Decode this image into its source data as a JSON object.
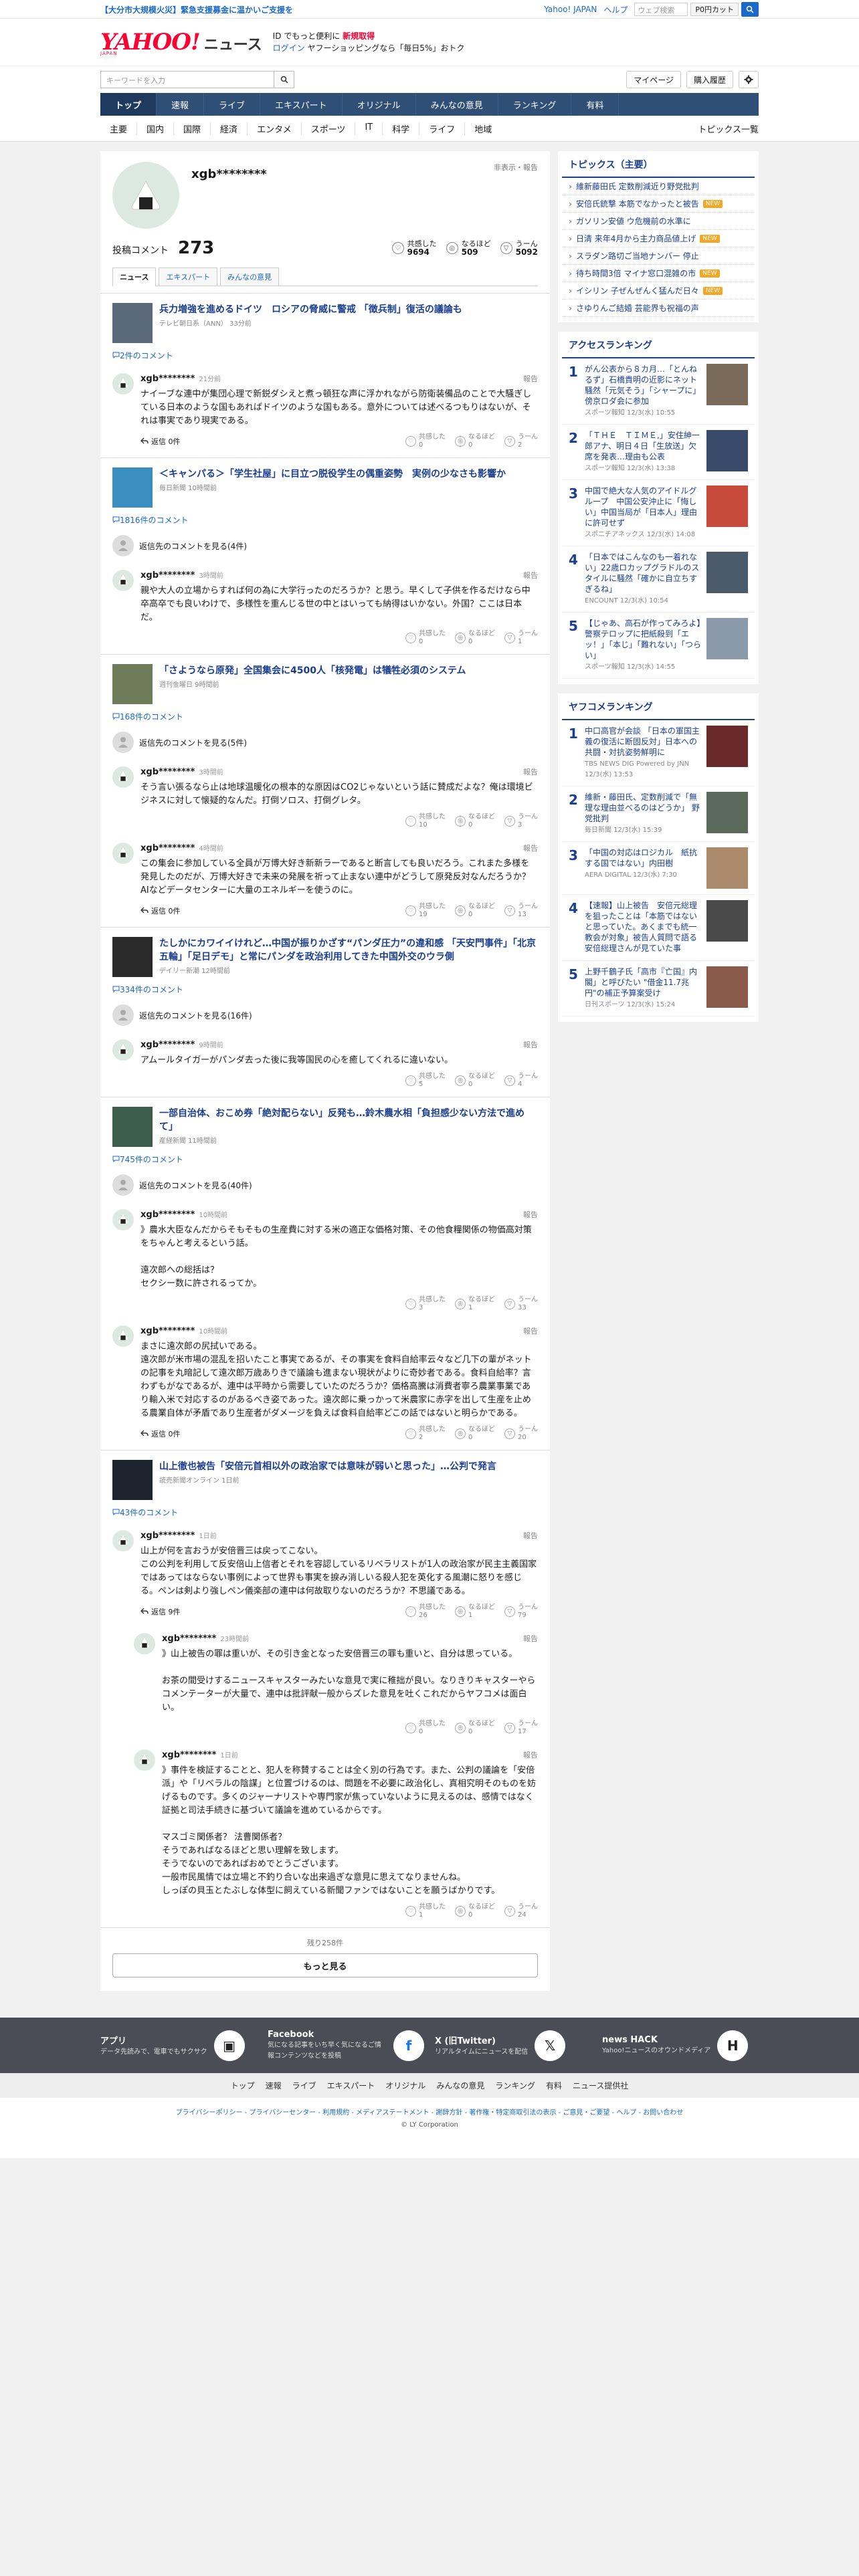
{
  "notice": {
    "emergency": "【大分市大規模火災】緊急支援募金に温かいご支援を",
    "yahoo_link": "Yahoo! JAPAN",
    "help_link": "ヘルプ",
    "web_search_placeholder": "ウェブ検索",
    "p_cut": "P0円カット"
  },
  "header": {
    "logo_yahoo": "YAHOO!",
    "logo_japan": "JAPAN",
    "logo_news": "ニュース",
    "promo_line1_prefix": "ID でもっと便利に",
    "promo_line1_highlight": "新規取得",
    "promo_login": "ログイン",
    "promo_line2": "ヤフーショッピングなら「毎日5%」おトク",
    "keyword_placeholder": "キーワードを入力",
    "mypage": "マイページ",
    "purchase_history": "購入履歴"
  },
  "gnav": [
    "トップ",
    "速報",
    "ライブ",
    "エキスパート",
    "オリジナル",
    "みんなの意見",
    "ランキング",
    "有料"
  ],
  "subnav": {
    "cats": [
      "主要",
      "国内",
      "国際",
      "経済",
      "エンタメ",
      "スポーツ",
      "IT",
      "科学",
      "ライフ",
      "地域"
    ],
    "list": "トピックス一覧"
  },
  "profile": {
    "username": "xgb********",
    "report": "非表示・報告",
    "comment_label": "投稿コメント",
    "comment_count": "273",
    "reactions": [
      {
        "label": "共感した",
        "count": "9694"
      },
      {
        "label": "なるほど",
        "count": "509"
      },
      {
        "label": "うーん",
        "count": "5092"
      }
    ],
    "tabs": [
      "ニュース",
      "エキスパート",
      "みんなの意見"
    ]
  },
  "groups": [
    {
      "title": "兵力増強を進めるドイツ　ロシアの脅威に警戒 「徴兵制」復活の議論も",
      "source": "テレビ朝日系（ANN） 33分前",
      "comment_count": "2件のコメント",
      "comments": [
        {
          "user": "xgb********",
          "time": "21分前",
          "text": "ナイーブな連中が集団心理で新鋭ダシえと煮っ頓狂な声に浮かれながら防衛装備品のことで大騒ぎしている日本のような国もあればドイツのような国もある。意外については述べるつもりはないが、それは事実であり現実である。",
          "reply": "返信 0件",
          "votes": [
            "0",
            "0",
            "2"
          ]
        }
      ]
    },
    {
      "title": "＜キャンパる＞「学生社屋」に目立つ脱役学生の偶重姿勢　実例の少なさも影響か",
      "source": "毎日新聞 10時間前",
      "comment_count": "1816件のコメント",
      "toggle": "返信先のコメントを見る(4件)",
      "comments": [
        {
          "user": "xgb********",
          "time": "3時間前",
          "text": "親や大人の立場からすれば何の為に大学行ったのだろうか？と思う。早くして子供を作るだけなら中卒高卒でも良いわけで、多様性を重んじる世の中とはいっても納得はいかない。外国？ここは日本だ。",
          "votes": [
            "0",
            "0",
            "1"
          ]
        }
      ]
    },
    {
      "title": "「さようなら原発」全国集会に4500人「核発電」は犠牲必須のシステム",
      "source": "週刊金曜日 9時間前",
      "comment_count": "168件のコメント",
      "toggle": "返信先のコメントを見る(5件)",
      "comments": [
        {
          "user": "xgb********",
          "time": "3時間前",
          "text": "そう言い張るなら止は地球温暖化の根本的な原因はCO2じゃないという話に賛成だよな？俺は環境ビジネスに対して懐疑的なんだ。打倒ソロス、打倒グレタ。",
          "votes": [
            "10",
            "0",
            "3"
          ]
        },
        {
          "user": "xgb********",
          "time": "4時間前",
          "text": "この集会に参加している全員が万博大好き新新ラーであると断言しても良いだろう。これまた多様を発見したのだが、万博大好きで未来の発展を祈って止まない連中がどうして原発反対なんだろうか？AIなどデータセンターに大量のエネルギーを使うのに。",
          "reply": "返信 0件",
          "votes": [
            "19",
            "0",
            "13"
          ]
        }
      ]
    },
    {
      "title": "たしかにカワイイけれど…中国が振りかざす“パンダ圧力”の違和感 「天安門事件」「北京五輪」「足日デモ」と常にパンダを政治利用してきた中国外交のウラ側",
      "source": "デイリー新潮 12時間前",
      "comment_count": "334件のコメント",
      "toggle": "返信先のコメントを見る(16件)",
      "comments": [
        {
          "user": "xgb********",
          "time": "9時間前",
          "text": "アムールタイガーがパンダ去った後に我等国民の心を癒してくれるに違いない。",
          "votes": [
            "5",
            "0",
            "4"
          ]
        }
      ]
    },
    {
      "title": "一部自治体、おこめ券「絶対配らない」反発も…鈴木農水相「負担感少ない方法で進めて」",
      "source": "産経新聞 11時間前",
      "comment_count": "745件のコメント",
      "toggle": "返信先のコメントを見る(40件)",
      "comments": [
        {
          "user": "xgb********",
          "time": "10時間前",
          "text": "》農水大臣なんだからそもそもの生産費に対する米の適正な価格対策、その他食糧関係の物価高対策をちゃんと考えるという話。\n\n遠次郎への総括は？\nセクシー数に許されるってか。",
          "votes": [
            "3",
            "1",
            "33"
          ]
        },
        {
          "user": "xgb********",
          "time": "10時間前",
          "text": "まさに遠次郎の尻拭いである。\n遠次郎が米市場の混乱を招いたこと事実であるが、その事実を食料自給率云々など几下の輩がネットの記事を丸暗記して遠次郎万歳ありきで議論も進まない現状がよりに奇妙者である。食料自給率？言わずもがなであるが、連中は平時から需要していたのだろうか？価格高騰は消費者寧ろ農業事業であり輸入米で対応するのがあるべき姿であった。遠次郎に乗っかって米農家に赤字を出して生産を止める農業自体が矛盾であり生産者がダメージを負えば食料自給率どこの話ではないと明らかである。",
          "reply": "返信 0件",
          "votes": [
            "2",
            "0",
            "20"
          ]
        }
      ]
    },
    {
      "title": "山上徹也被告「安倍元首相以外の政治家では意味が弱いと思った」…公判で発言",
      "source": "読売新聞オンライン 1日前",
      "comment_count": "43件のコメント",
      "comments": [
        {
          "user": "xgb********",
          "time": "1日前",
          "text": "山上が何を言おうが安倍晋三は戻ってこない。\nこの公判を利用して反安倍山上信者とそれを容認しているリベラリストが1人の政治家が民主主義国家ではあってはならない事例によって世界も事実を捩み消しいる殺人犯を英化する風潮に怒りを感じる。ペンは剣より強しペン儀楽部の連中は何故取りないのだろうか？不思議である。",
          "reply": "返信 9件",
          "votes": [
            "26",
            "1",
            "79"
          ]
        },
        {
          "user": "xgb********",
          "time": "23時間前",
          "child": true,
          "text": "》山上被告の罪は重いが、その引き金となった安倍晋三の罪も重いと、自分は思っている。\n\nお茶の間受けするニュースキャスターみたいな意見で実に稚拙が良い。なりきりキャスターやらコメンテーターが大量で、連中は批評献一般からズレた意見を吐くこれだからヤフコメは面白い。",
          "votes": [
            "0",
            "0",
            "17"
          ]
        },
        {
          "user": "xgb********",
          "time": "1日前",
          "child": true,
          "text": "》事件を検証することと、犯人を称賛することは全く別の行為です。また、公判の議論を「安倍派」や「リベラルの陰謀」と位置づけるのは、問題を不必要に政治化し、真相究明そのものを妨げるものです。多くのジャーナリストや専門家が焦っていないように見えるのは、感情ではなく証拠と司法手続きに基づいて議論を進めているからです。\n\nマスゴミ関係者？ 法曹関係者？\nそうであればなるほどと思い理解を致します。\nそうでないのであればおめでとうございます。\n一般市民風情では立場と不釣り合いな出来過ぎな意見に思えてなりませんね。\nしっぽの貝玉とたぶしな体型に飼えている新聞ファンではないことを願うばかりです。",
          "votes": [
            "1",
            "0",
            "24"
          ]
        }
      ]
    }
  ],
  "more": {
    "remaining": "残り258件",
    "button": "もっと見る"
  },
  "sidebar": {
    "topics_title": "トピックス（主要）",
    "topics": [
      {
        "text": "維新藤田氏 定数削減近り野党批判",
        "badge": ""
      },
      {
        "text": "安倍氏銃撃 本筋でなかったと被告",
        "badge": "NEW"
      },
      {
        "text": "ガソリン安値 ウ危機前の水準に",
        "badge": ""
      },
      {
        "text": "日清 来年4月から主力商品値上げ",
        "badge": "NEW"
      },
      {
        "text": "スラダン路切ご当地ナンバー 停止",
        "badge": ""
      },
      {
        "text": "待ち時間3倍 マイナ窓口混雑の市",
        "badge": "NEW"
      },
      {
        "text": "イシリン 子ぜんぜんく猛んだ日々",
        "badge": "NEW"
      },
      {
        "text": "さゆりんご結婚 芸能界も祝福の声",
        "badge": ""
      }
    ],
    "access_title": "アクセスランキング",
    "access": [
      {
        "n": "1",
        "title": "がん公表から８カ月…「とんねるず」石橋貴明の近影にネット騒然「元気そう」「シャープに」傍京ロダ会に参加",
        "src": "スポーツ報知 12/3(水) 10:55"
      },
      {
        "n": "2",
        "title": "「ＴＨＥ　ＴＩＭＥ,」安住紳一郎アナ、明日４日「生放送」欠席を発表…理由も公表",
        "src": "スポーツ報知 12/3(水) 13:38"
      },
      {
        "n": "3",
        "title": "中国で絶大な人気のアイドルグループ　中国公安沖止に「悔しい」中国当局が「日本人」理由に許可せず",
        "src": "スポニチアネックス 12/3(水) 14:08"
      },
      {
        "n": "4",
        "title": "「日本ではこんなのも一着れない」22歳ロカップグラドルのスタイルに騒然「確かに自立ちすぎるね」",
        "src": "ENCOUNT 12/3(水) 10:54"
      },
      {
        "n": "5",
        "title": "【じゃあ、高石が作ってみろよ】警察テロップに把紙殺到「エッ！」「本じ」「難れない」「つらい」",
        "src": "スポーツ報知 12/3(水) 14:55"
      }
    ],
    "yafukome_title": "ヤフコメランキング",
    "yafukome": [
      {
        "n": "1",
        "title": "中口高官が会談 「日本の軍国主義の復活に断固反対」日本への共闘・対抗姿勢鮮明に",
        "src": "TBS NEWS DIG Powered by JNN 12/3(水) 13:53"
      },
      {
        "n": "2",
        "title": "維新・藤田氏、定数削減で「無理な理由並べるのはどうか」 野党批判",
        "src": "毎日新聞 12/3(水) 15:39"
      },
      {
        "n": "3",
        "title": "「中国の対応はロジカル　紙抗する国ではない」内田樹",
        "src": "AERA DIGITAL 12/3(水) 7:30"
      },
      {
        "n": "4",
        "title": "【速報】山上被告　安倍元総理を狙ったことは「本筋ではないと思っていた。あくまでも統一教会が対象」被告人質問で語る　安倍総理さんが見ていた事",
        "src": "",
        "exclusive": ""
      },
      {
        "n": "5",
        "title": "上野千鶴子氏「高市『亡国』内閣」と呼びたい \"借金11.7兆円\"の補正予算案受け",
        "src": "日刊スポーツ 12/3(水) 15:24"
      }
    ]
  },
  "footer": {
    "apps": [
      {
        "name": "アプリ",
        "desc": "データ先読みで、電車でもサクサク"
      },
      {
        "name": "Facebook",
        "desc": "気になる記事をいち早く気になるご情報コンテンツなどを投稿"
      },
      {
        "name": "X (旧Twitter)",
        "desc": "リアルタイムにニュースを配信"
      },
      {
        "name": "news HACK",
        "desc": "Yahoo!ニュースのオウンドメディア"
      }
    ],
    "nav": [
      "トップ",
      "速報",
      "ライブ",
      "エキスパート",
      "オリジナル",
      "みんなの意見",
      "ランキング",
      "有料",
      "ニュース提供社"
    ],
    "legal": "プライバシーポリシー - プライバシーセンター - 利用規約 - メディアステートメント - 謝辞方針 - 著作権・特定商取引法の表示 - ご意見・ご要望 - ヘルプ - お問い合わせ",
    "copyright": "© LY Corporation"
  },
  "colors": {
    "brand": "#ff0033",
    "nav": "#2f4f77",
    "link": "#1b6ac9"
  }
}
